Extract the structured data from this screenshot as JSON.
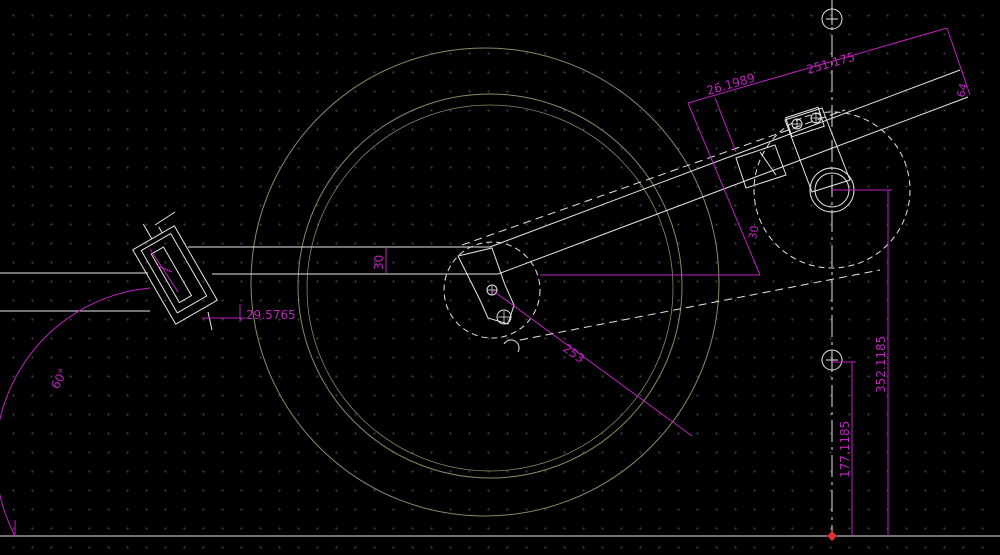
{
  "colors": {
    "background": "#000000",
    "grid": "#3a3a3a",
    "geometry": "#e6e6e6",
    "dimension": "#c020c0",
    "wheel": "#8a8a62",
    "origin_marker": "#e03030"
  },
  "dimensions": {
    "angle_60": "60°",
    "dim_29_5765": "29.5765",
    "dim_30_vertical": "30",
    "dim_253": "253",
    "dim_26_1989": "26.1989",
    "dim_251_175": "251.175",
    "dim_30_angled": "30",
    "dim_64": "64",
    "dim_352_1185": "352.1185",
    "dim_177_1185": "177.1185"
  },
  "markers": {
    "centerline_top": "crosshair-circle",
    "centerline_bottom": "crosshair-circle",
    "origin": "origin-marker"
  }
}
